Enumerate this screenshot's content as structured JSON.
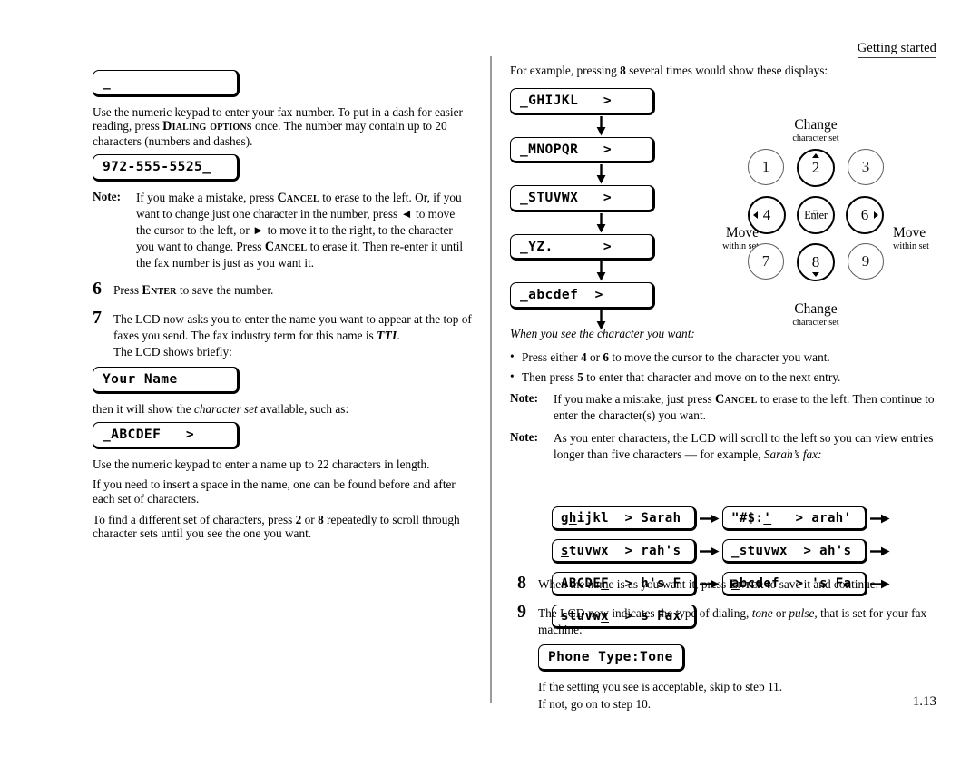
{
  "running_head": "Getting started",
  "page_folio": "1.13",
  "left_column": {
    "lcd_empty": "_",
    "para_fax_number": "Use the numeric keypad to enter your fax number. To put in a dash for easier reading, press ",
    "dialing_options_key": "Dialing options",
    "para_fax_number_2": " once. The number may contain up to 20 characters (numbers and dashes).",
    "lcd_fax_number": "972-555-5525_",
    "note1": {
      "label": "Note:",
      "part1": "If you make a mistake, press ",
      "cancel_key": "Cancel",
      "part2": " to erase to the left. Or, if you want to change just one character in the number, press ◄ to move the cursor to the left, or ► to move it to the right, to the character you want to change. Press ",
      "cancel_key2": "Cancel",
      "part3": " to erase it. Then re-enter it until the fax number is just as you want it."
    },
    "step6": {
      "num": "6",
      "part1": "Press ",
      "enter_key": "Enter",
      "part2": " to save the number."
    },
    "step7": {
      "num": "7",
      "part1": "The ",
      "lcd_abbr": "LCD",
      "part2": " now asks you to enter the name you want to appear at the top of faxes you send. The fax industry term for this name is ",
      "tti_abbr": "TTI",
      "part3": ".",
      "part4": "The ",
      "lcd_abbr2": "LCD",
      "part5": " shows briefly:"
    },
    "lcd_your_name": "Your Name",
    "para_then": {
      "part1": "then it will show the ",
      "italic": "character set",
      "part2": " available, such as:"
    },
    "lcd_abcdef": "_ABCDEF   >",
    "para_22chars": "Use the numeric keypad to enter a name up to 22 characters in length.",
    "para_space": "If you need to insert a space in the name, one can be found before and after each set of characters.",
    "para_scroll": {
      "part1": "To find a different set of characters, press ",
      "key_a": "2",
      "mid": " or ",
      "key_b": "8",
      "part2": " repeatedly to scroll through character sets until you see the one you want."
    }
  },
  "right_column": {
    "intro": {
      "part1": "For example, pressing ",
      "key": "8",
      "part2": " several times would show these displays:"
    },
    "lcd_chain": [
      "_GHIJKL   >",
      "_MNOPQR   >",
      "_STUVWX   >",
      "_YZ.      >",
      "_abcdef  >"
    ],
    "keypad": {
      "caption_top_big": "Change",
      "caption_top_small": "character set",
      "caption_bottom_big": "Change",
      "caption_bottom_small": "character set",
      "caption_left_big": "Move",
      "caption_left_small": "within set",
      "caption_right_big": "Move",
      "caption_right_small": "within set",
      "keys": [
        {
          "label": "1",
          "highlight": false,
          "arrow": ""
        },
        {
          "label": "2",
          "highlight": true,
          "arrow": "up"
        },
        {
          "label": "3",
          "highlight": false,
          "arrow": ""
        },
        {
          "label": "4",
          "highlight": true,
          "arrow": "left"
        },
        {
          "label": "Enter",
          "ghost": "5",
          "highlight": true,
          "arrow": ""
        },
        {
          "label": "6",
          "highlight": true,
          "arrow": "right"
        },
        {
          "label": "7",
          "highlight": false,
          "arrow": ""
        },
        {
          "label": "8",
          "highlight": true,
          "arrow": "down"
        },
        {
          "label": "9",
          "highlight": false,
          "arrow": ""
        }
      ]
    },
    "when_you_see": "When you see the character you want:",
    "bullet1": {
      "part1": "Press either ",
      "key_a": "4",
      "mid": " or ",
      "key_b": "6",
      "part2": " to move the cursor to the character you want."
    },
    "bullet2": {
      "part1": "Then press ",
      "key": "5",
      "part2": " to enter that character and move on to the next entry."
    },
    "note_a": {
      "label": "Note:",
      "part1": "If you make a mistake, just press ",
      "cancel_key": "Cancel",
      "part2": " to erase to the left. Then continue to enter the character(s) you want."
    },
    "note_b": {
      "label": "Note:",
      "part1": "As you enter characters, the ",
      "lcd_abbr": "LCD",
      "part2": " will scroll to the left so you can view entries longer than five characters — for example, ",
      "italic": "Sarah’s fax:"
    },
    "lcd_grid": [
      {
        "left": {
          "pre": "g",
          "under": "h",
          "post": "ijkl  > Sarah"
        },
        "right": {
          "pre": "\"#$:",
          "under": "'",
          "post": "   > arah'"
        }
      },
      {
        "left": {
          "pre": "",
          "under": "s",
          "post": "tuvwx  > rah's"
        },
        "right": {
          "pre": "_stuvwx  > ah's",
          "under": "",
          "post": ""
        }
      },
      {
        "left": {
          "pre": "ABCDE",
          "under": "F",
          "post": "  > h's F"
        },
        "right": {
          "pre": "",
          "under": "a",
          "post": "bcdef  > 's Fa"
        }
      },
      {
        "left": {
          "pre": "stuvw",
          "under": "x",
          "post": "  > s Fax"
        },
        "right": null
      }
    ],
    "step8": {
      "num": "8",
      "part1": "When the name is as you want it, press ",
      "enter_key": "Enter",
      "part2": " to save it and continue."
    },
    "step9": {
      "num": "9",
      "part1": "The ",
      "lcd_abbr": "LCD",
      "part2": " now indicates the type of dialing, ",
      "italic_a": "tone",
      "mid": " or ",
      "italic_b": "pulse,",
      "part3": " that is set for your fax machine:"
    },
    "lcd_phone_type": "Phone Type:Tone",
    "closing_line1": "If the setting you see is acceptable, skip to step 11.",
    "closing_line2": "If not, go on to step 10."
  }
}
